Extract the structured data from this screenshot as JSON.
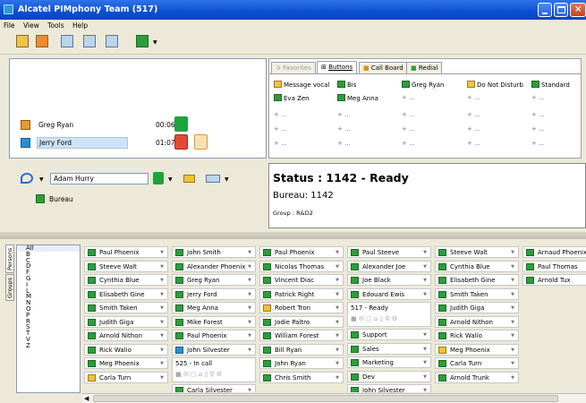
{
  "window": {
    "title": "Alcatel PIMphony Team (517)"
  },
  "menu": [
    "File",
    "View",
    "Tools",
    "Help"
  ],
  "calls": [
    {
      "name": "Greg Ryan",
      "duration": "00:06",
      "selected": false
    },
    {
      "name": "Jerry Ford",
      "duration": "01:07",
      "selected": true
    }
  ],
  "tabs": [
    "Favorites",
    "Buttons",
    "Call Board",
    "Redial"
  ],
  "buttons": [
    [
      {
        "label": "Message vocal",
        "icon": "voicemail-icon"
      },
      {
        "label": "Bis",
        "icon": "redial-icon"
      },
      {
        "label": "Greg Ryan",
        "icon": "contact-icon"
      },
      {
        "label": "Do Not Disturb",
        "icon": "dnd-icon"
      },
      {
        "label": "Standard",
        "icon": "standard-icon"
      }
    ],
    [
      {
        "label": "Eva Zen",
        "icon": "contact-icon"
      },
      {
        "label": "Meg Anna",
        "icon": "contact-icon"
      },
      {
        "label": "+   ...",
        "icon": ""
      },
      {
        "label": "+   ...",
        "icon": ""
      },
      {
        "label": "+   ...",
        "icon": ""
      }
    ]
  ],
  "empty_slot": "+   ...",
  "dial": {
    "value": "Adam Hurry",
    "location": "Bureau"
  },
  "status": {
    "line1": "Status : 1142 - Ready",
    "line2": "Bureau: 1142",
    "line3": "Group : R&D2"
  },
  "side_tabs": [
    "Persons",
    "Groups"
  ],
  "letters": [
    "All",
    "B",
    "C",
    "D",
    "F",
    "G",
    "I",
    "L",
    "M",
    "N",
    "O",
    "P",
    "R",
    "S",
    "T",
    "V",
    "Z"
  ],
  "columns": [
    [
      {
        "name": "Paul Phoenix"
      },
      {
        "name": "Steeve Walt"
      },
      {
        "name": "Cynthia Blue"
      },
      {
        "name": "Elisabeth Gine"
      },
      {
        "name": "Smith Taken"
      },
      {
        "name": "Judith Giga"
      },
      {
        "name": "Arnold Nithon"
      },
      {
        "name": "Rick Walio"
      },
      {
        "name": "Meg Phoenix"
      },
      {
        "name": "Carla Turn",
        "icon": "o"
      }
    ],
    [
      {
        "name": "John Smith"
      },
      {
        "name": "Alexander Phoenix"
      },
      {
        "name": "Greg Ryan"
      },
      {
        "name": "Jerry Ford"
      },
      {
        "name": "Meg Anna"
      },
      {
        "name": "Mike Forest"
      },
      {
        "name": "Paul Phoenix"
      },
      {
        "name": "John Silvester",
        "icon": "b"
      },
      {
        "name": "525 - In call",
        "expanded": true
      },
      {
        "name": "Carla Silvester"
      }
    ],
    [
      {
        "name": "Paul Phoenix"
      },
      {
        "name": "Nicolas Thomas"
      },
      {
        "name": "Vincent Diac"
      },
      {
        "name": "Patrick Right"
      },
      {
        "name": "Robert Tron",
        "icon": "o"
      },
      {
        "name": "Jodie Paltro"
      },
      {
        "name": "William Forest"
      },
      {
        "name": "Bill Ryan"
      },
      {
        "name": "John Ryan"
      },
      {
        "name": "Chris Smith"
      }
    ],
    [
      {
        "name": "Paul Steeve"
      },
      {
        "name": "Alexander Joe"
      },
      {
        "name": "Joe Black"
      },
      {
        "name": "Edouard Ewis"
      },
      {
        "name": "517 - Ready",
        "expanded": true
      },
      {
        "name": "Support"
      },
      {
        "name": "Sales"
      },
      {
        "name": "Marketing"
      },
      {
        "name": "Dev"
      },
      {
        "name": "John Silvester"
      }
    ],
    [
      {
        "name": "Steeve Walt"
      },
      {
        "name": "Cynthia Blue"
      },
      {
        "name": "Elisabeth Gine"
      },
      {
        "name": "Smith Taken"
      },
      {
        "name": "Judith Giga"
      },
      {
        "name": "Arnold Nithon"
      },
      {
        "name": "Rick Walio"
      },
      {
        "name": "Meg Phoenix",
        "icon": "o"
      },
      {
        "name": "Carla Turn"
      },
      {
        "name": "Arnold Trunk"
      }
    ],
    [
      {
        "name": "Arnaud Phoenix"
      },
      {
        "name": "Paul Thomas"
      },
      {
        "name": "Arnold Tux"
      }
    ]
  ]
}
